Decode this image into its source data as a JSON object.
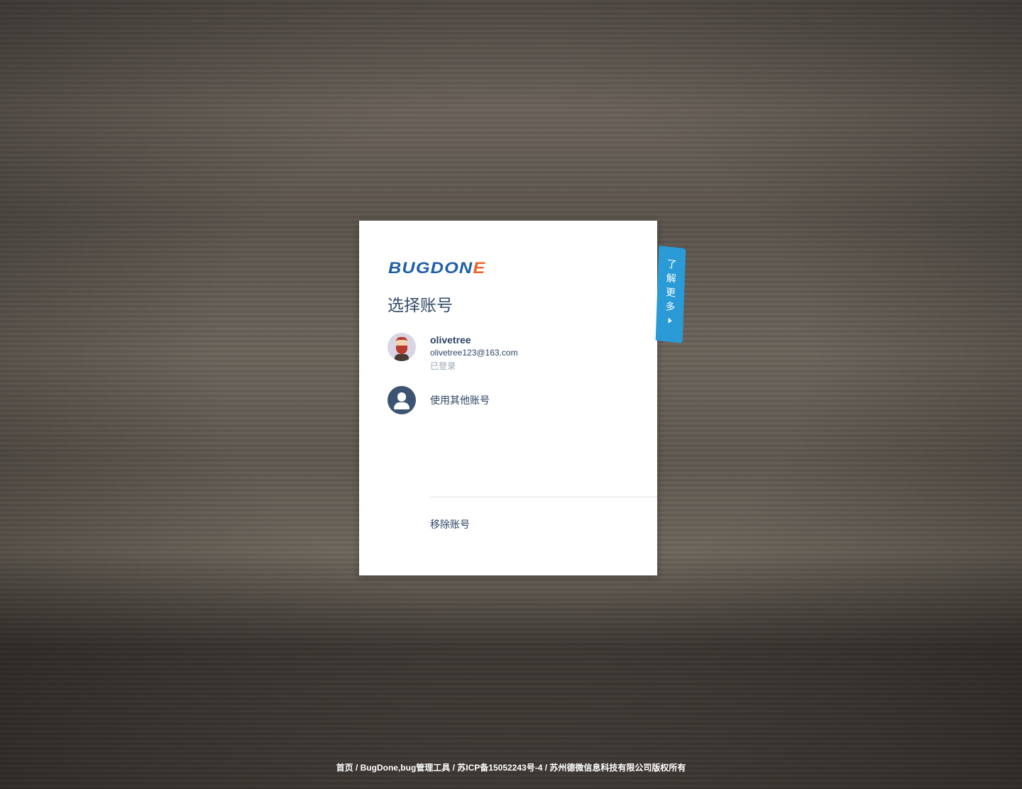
{
  "logo": {
    "main": "BUGDON",
    "accent": "E"
  },
  "title": "选择账号",
  "account": {
    "name": "olivetree",
    "email": "olivetree123@163.com",
    "status": "已登录"
  },
  "other_account": "使用其他账号",
  "remove_account": "移除账号",
  "side_tab": {
    "chars": [
      "了",
      "解",
      "更",
      "多"
    ]
  },
  "footer": {
    "home": "首页",
    "sep": " / ",
    "product": "BugDone,bug管理工具",
    "icp": "苏ICP备15052243号-4",
    "copyright": "苏州德微信息科技有限公司版权所有"
  },
  "colors": {
    "brand": "#1f5fa8",
    "accent": "#e8642a",
    "tab": "#2a9bd6",
    "text": "#2c4466"
  }
}
